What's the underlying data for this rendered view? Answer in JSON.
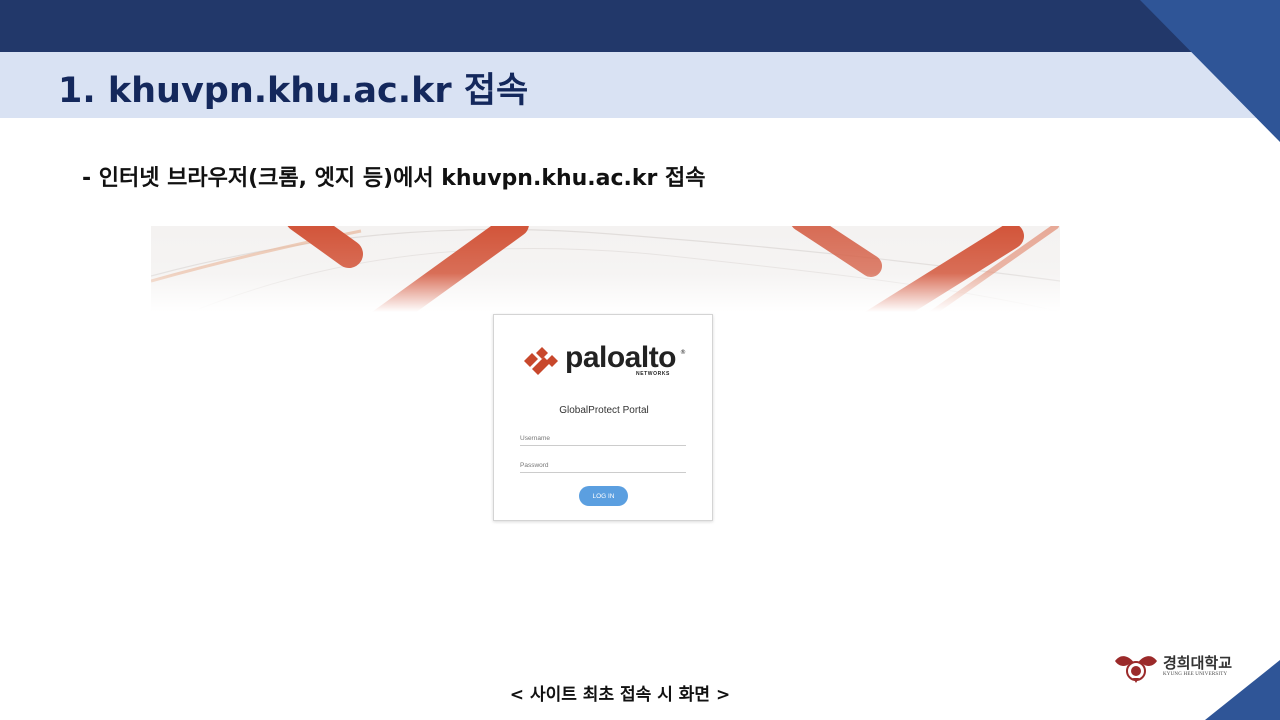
{
  "slide": {
    "title": "1. khuvpn.khu.ac.kr 접속",
    "subtitle": "- 인터넷 브라우저(크롬, 엣지 등)에서 khuvpn.khu.ac.kr 접속",
    "caption": "< 사이트 최초 접속 시 화면 >"
  },
  "login": {
    "brand": "paloalto",
    "brand_registered": "®",
    "brand_sub": "NETWORKS",
    "portal_title": "GlobalProtect Portal",
    "username_placeholder": "Username",
    "password_placeholder": "Password",
    "login_button": "LOG IN"
  },
  "university": {
    "name": "경희대학교",
    "name_en": "KYUNG HEE UNIVERSITY"
  },
  "colors": {
    "header_navy": "#22386a",
    "title_band": "#d9e2f3",
    "title_text": "#14285c",
    "corner_blue": "#2f5597",
    "brand_orange": "#c8482c",
    "login_button": "#5b9fe0"
  }
}
